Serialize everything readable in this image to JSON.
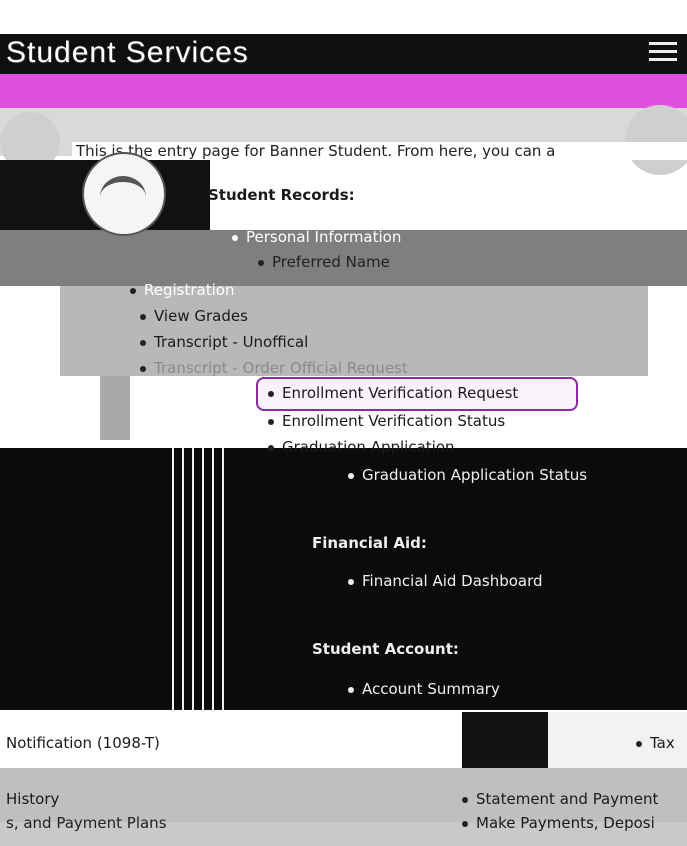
{
  "header": {
    "title": "Student Services",
    "menu_icon": "hamburger-menu-icon",
    "accent_color": "#e04fe0"
  },
  "intro_text": "This is the entry page for Banner Student. From here, you can a",
  "student_records": {
    "heading": "Student Records:",
    "items": [
      "Personal Information",
      "Preferred Name",
      "Registration",
      "View Grades",
      "Transcript - Unoffical",
      "Transcript - Order Official Request",
      "Enrollment Verification Request",
      "Enrollment Verification Status",
      "Graduation Application",
      "Graduation Application Status"
    ]
  },
  "financial_aid": {
    "heading": "Financial Aid:",
    "items": [
      "Financial Aid Dashboard"
    ]
  },
  "student_account": {
    "heading": "Student Account:",
    "items": [
      "Account Summary"
    ]
  },
  "left_column": {
    "tax_notification": "Notification (1098-T)",
    "history": "History",
    "payment_plans": "s, and Payment Plans"
  },
  "right_column": {
    "tax": "Tax",
    "statement": "Statement and Payment",
    "make_payments": "Make Payments, Deposi"
  },
  "highlight_color": "#8a2c9e"
}
